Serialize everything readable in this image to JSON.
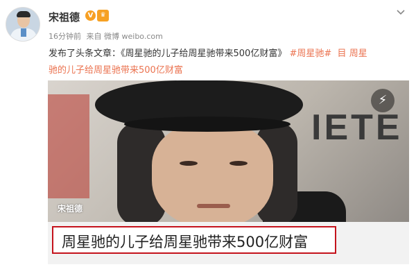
{
  "user": {
    "name": "宋祖德",
    "verified_badge": "V",
    "member_badge": "会员",
    "time": "16分钟前",
    "source": "来自 微博 weibo.com"
  },
  "post": {
    "prefix": "发布了头条文章：",
    "article_title_quoted": "《周星驰的儿子给周星驰带来500亿财富》",
    "hashtag": "#周星驰#",
    "link_icon": "目",
    "link_text_part1": "周星",
    "link_text_part2": "驰的儿子给周星驰带来500亿财富"
  },
  "card": {
    "photo_sign": "IETE",
    "watermark": "宋祖德",
    "share_icon": "⚡",
    "title": "周星驰的儿子给周星驰带来500亿财富"
  },
  "colors": {
    "accent": "#eb7350",
    "border_red": "#c4121b",
    "badge_orange": "#f7a023"
  },
  "icons": {
    "menu": "chevron-down-icon",
    "share": "lightning-icon",
    "verified": "verified-v-icon"
  }
}
